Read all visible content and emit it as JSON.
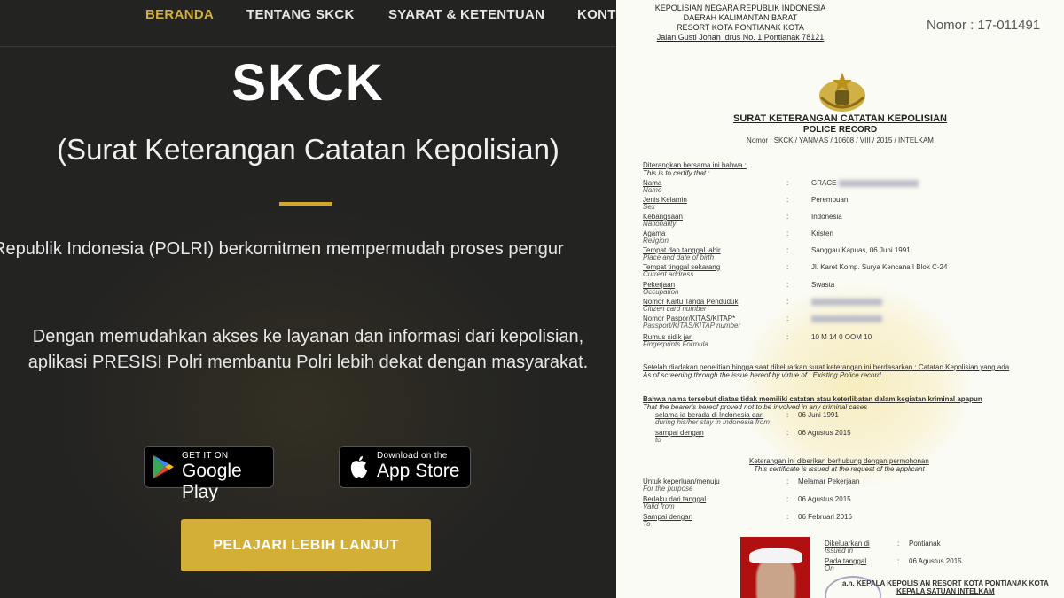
{
  "nav": {
    "items": [
      "BERANDA",
      "TENTANG SKCK",
      "SYARAT & KETENTUAN",
      "KONT"
    ],
    "active_index": 0
  },
  "hero": {
    "title": "SKCK",
    "subtitle": "(Surat Keterangan Catatan Kepolisian)",
    "paragraph1": "Republik Indonesia (POLRI) berkomitmen mempermudah proses pengur",
    "paragraph2_line1": "Dengan memudahkan akses ke layanan dan informasi dari kepolisian,",
    "paragraph2_line2": "aplikasi PRESISI Polri membantu Polri lebih dekat dengan masyarakat."
  },
  "stores": {
    "google_small": "GET IT ON",
    "google_big": "Google Play",
    "apple_small": "Download on the",
    "apple_big": "App Store"
  },
  "cta": {
    "label": "PELAJARI LEBIH LANJUT"
  },
  "colors": {
    "accent": "#d4af37",
    "background": "#232322"
  },
  "document": {
    "header_lines": [
      "KEPOLISIAN NEGARA REPUBLIK INDONESIA",
      "DAERAH KALIMANTAN BARAT",
      "RESORT KOTA PONTIANAK KOTA",
      "Jalan Gusti Johan Idrus No. 1 Pontianak 78121"
    ],
    "nomor": "Nomor : 17-011491",
    "title": "SURAT KETERANGAN CATATAN KEPOLISIAN",
    "subtitle": "POLICE RECORD",
    "number_line": "Nomor : SKCK / YANMAS / 10608 / VIII / 2015 / INTELKAM",
    "intro_id": "Diterangkan bersama ini bahwa :",
    "intro_en": "This is to certify that :",
    "fields": [
      {
        "label": "Nama",
        "en": "Name",
        "value": "GRACE"
      },
      {
        "label": "Jenis Kelamin",
        "en": "Sex",
        "value": "Perempuan"
      },
      {
        "label": "Kebangsaan",
        "en": "Nationality",
        "value": "Indonesia"
      },
      {
        "label": "Agama",
        "en": "Religion",
        "value": "Kristen"
      },
      {
        "label": "Tempat dan tanggal lahir",
        "en": "Place and date of birth",
        "value": "Sanggau Kapuas, 06 Juni 1991"
      },
      {
        "label": "Tempat tinggal sekarang",
        "en": "Current address",
        "value": "Jl. Karet Komp. Surya Kencana I Blok C-24"
      },
      {
        "label": "Pekerjaan",
        "en": "Occupation",
        "value": "Swasta"
      },
      {
        "label": "Nomor Kartu Tanda Penduduk",
        "en": "Citizen card number",
        "value": ""
      },
      {
        "label": "Nomor Paspor/KITAS/KITAP*",
        "en": "Passport/KITAS/KITAP number",
        "value": ""
      },
      {
        "label": "Rumus sidik jari",
        "en": "Fingerprints Formula",
        "value": "10 M 14 0 OOM 10"
      }
    ],
    "para_a": "Setelah diadakan penelitian hingga saat dikeluarkan surat keterangan ini berdasarkan : Catatan Kepolisian yang ada",
    "para_a_en": "As of screening through the issue hereof by virtue of : Existing Police record",
    "para_b": "Bahwa nama tersebut diatas tidak memiliki catatan atau keterlibatan dalam kegiatan kriminal apapun",
    "para_b_en": "That the bearer's hereof proved not to be involved in any criminal cases",
    "stay_label": "selama ia berada di Indonesia dari",
    "stay_en": "during his/her stay in Indonesia from",
    "stay_value": "06 Juni 1991",
    "until_label": "sampai dengan",
    "until_en": "to",
    "until_value": "06 Agustus 2015",
    "note": "Keterangan ini diberikan berhubung dengan permohonan",
    "note_en": "This certificate is issued at the request of the applicant",
    "purpose_label": "Untuk keperluan/menuju",
    "purpose_en": "For the purpose",
    "purpose_value": "Melamar Pekerjaan",
    "valid_label": "Berlaku dari tanggal",
    "valid_en": "Valid from",
    "valid_value": "06 Agustus 2015",
    "to_label": "Sampai dengan",
    "to_en": "To",
    "to_value": "06 Februari 2016",
    "issued_label": "Dikeluarkan di",
    "issued_en": "Issued in",
    "issued_value": "Pontianak",
    "date_label": "Pada tanggal",
    "date_en": "On",
    "date_value": "06 Agustus 2015",
    "signer": "a.n. KEPALA KEPOLISIAN RESORT KOTA PONTIANAK KOTA",
    "signer2": "KEPALA SATUAN INTELKAM"
  }
}
